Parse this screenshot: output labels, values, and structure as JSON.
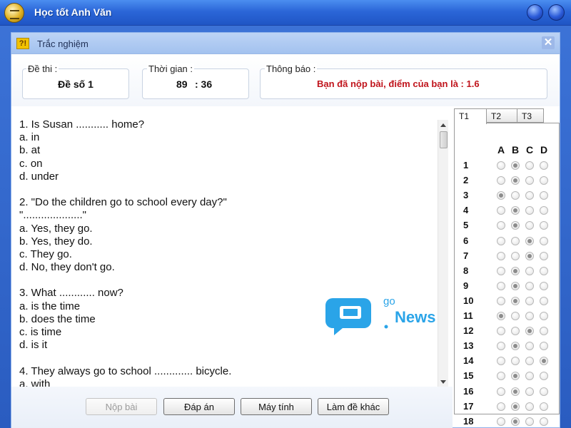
{
  "app": {
    "title": "Học tốt Anh Văn"
  },
  "dialog": {
    "title": "Trắc nghiệm",
    "close_glyph": "✕",
    "icon_glyph": "?!"
  },
  "info": {
    "exam_label": "Đề thi :",
    "exam_value": "Đề số 1",
    "time_label": "Thời gian :",
    "time_minutes": "89",
    "time_seconds": ": 36",
    "notice_label": "Thông báo :",
    "notice_value": "Bạn đã nộp bài, điểm của bạn là : 1.6"
  },
  "questions_text": [
    "1. Is Susan ........... home?",
    "a. in",
    "b. at",
    "c. on",
    "d. under",
    "",
    "2. \"Do the children go to school every day?\"",
    "\"....................\"",
    "a. Yes, they go.",
    "b. Yes, they do.",
    "c. They go.",
    "d. No, they don't go.",
    "",
    "3. What ............ now?",
    "a. is the time",
    "b. does the time",
    "c. is time",
    "d. is it",
    "",
    "4. They always go to school ............. bicycle.",
    "a. with"
  ],
  "watermark": {
    "go": "go",
    "news": "News"
  },
  "answer_sheet": {
    "tabs": [
      "T1",
      "T2",
      "T3"
    ],
    "active_tab": "T1",
    "columns": [
      "A",
      "B",
      "C",
      "D"
    ],
    "rows": [
      {
        "num": "1",
        "selected": "B"
      },
      {
        "num": "2",
        "selected": "B"
      },
      {
        "num": "3",
        "selected": "A"
      },
      {
        "num": "4",
        "selected": "B"
      },
      {
        "num": "5",
        "selected": "B"
      },
      {
        "num": "6",
        "selected": "C"
      },
      {
        "num": "7",
        "selected": "C"
      },
      {
        "num": "8",
        "selected": "B"
      },
      {
        "num": "9",
        "selected": "B"
      },
      {
        "num": "10",
        "selected": "B"
      },
      {
        "num": "11",
        "selected": "A"
      },
      {
        "num": "12",
        "selected": "C"
      },
      {
        "num": "13",
        "selected": "B"
      },
      {
        "num": "14",
        "selected": "D"
      },
      {
        "num": "15",
        "selected": "B"
      },
      {
        "num": "16",
        "selected": "B"
      },
      {
        "num": "17",
        "selected": "B"
      },
      {
        "num": "18",
        "selected": "B"
      }
    ]
  },
  "buttons": {
    "submit": "Nộp bài",
    "answers": "Đáp án",
    "calculator": "Máy tính",
    "new_exam": "Làm đề khác"
  },
  "colors": {
    "notice_text": "#c0141c",
    "app_titlebar": "#2b66d8",
    "watermark": "#2aa4e8"
  }
}
